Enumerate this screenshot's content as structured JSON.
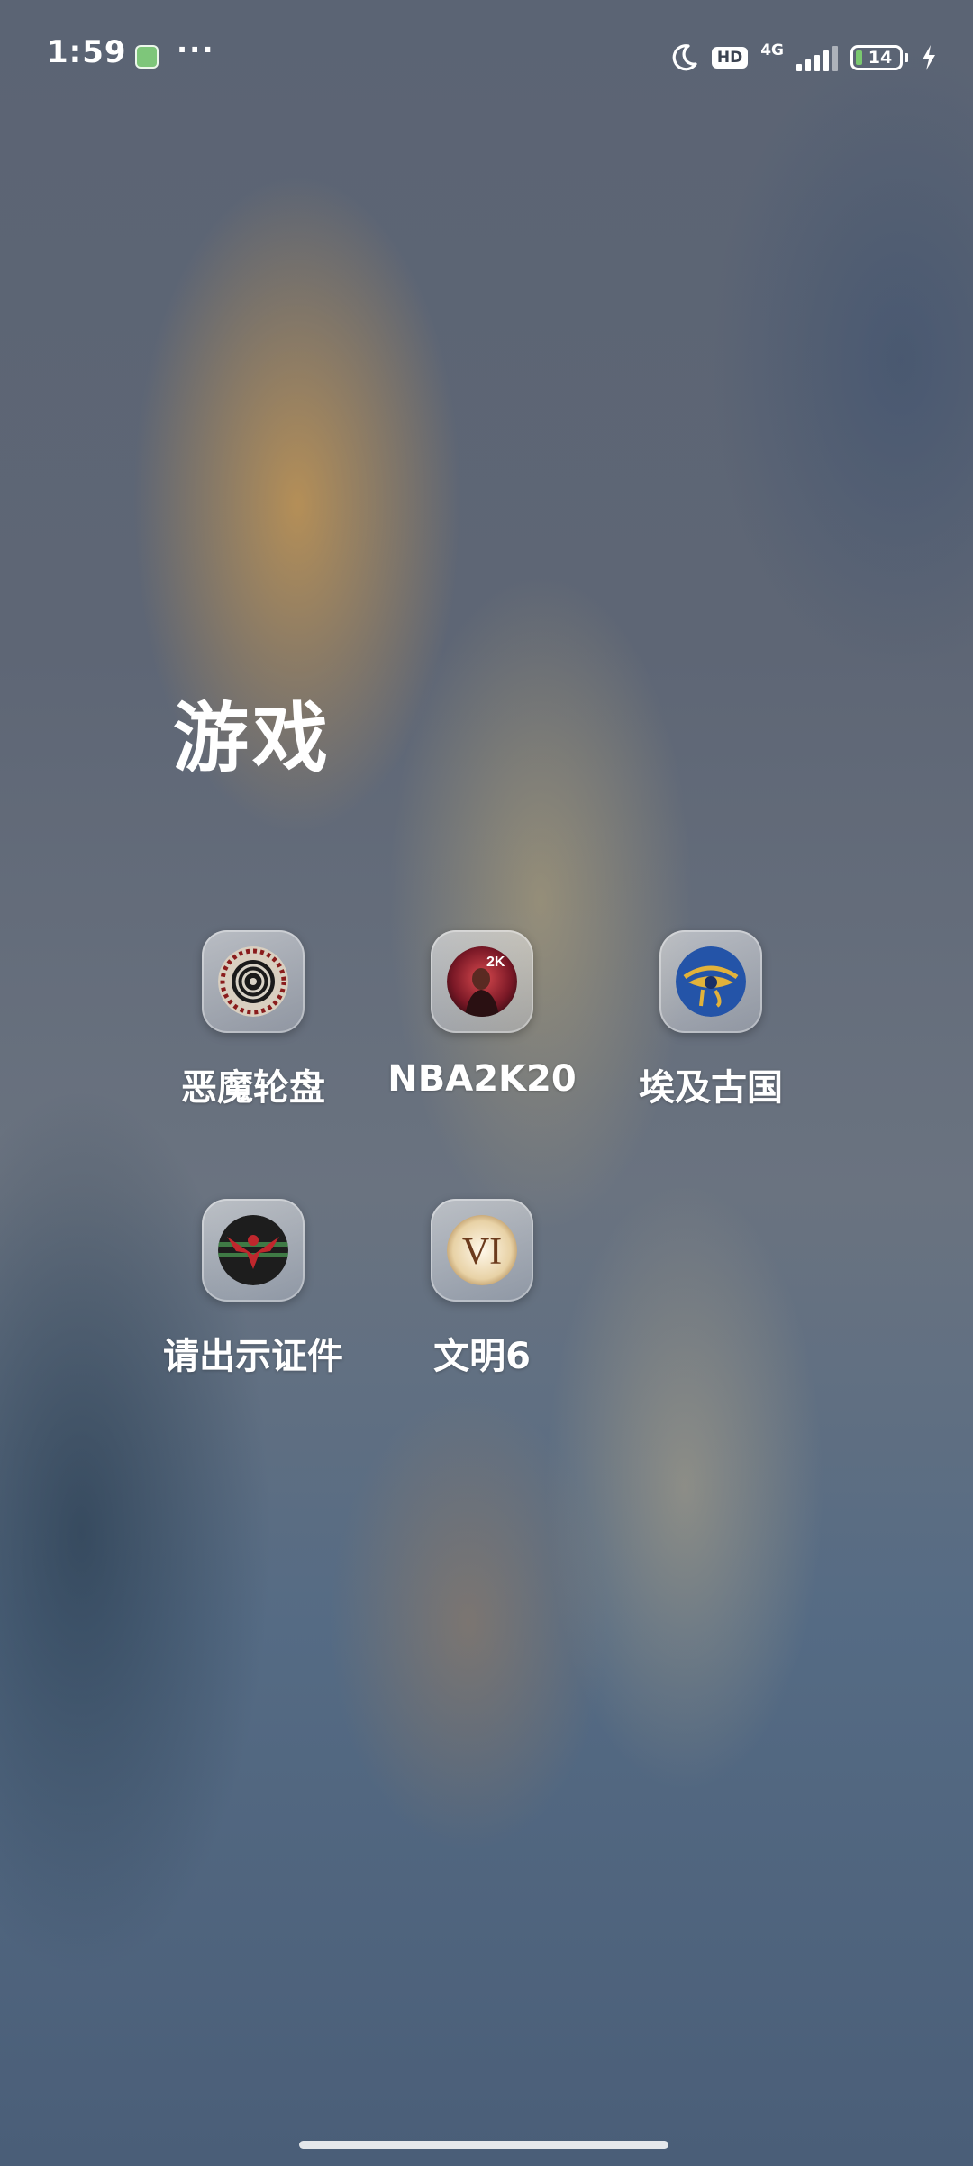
{
  "status_bar": {
    "time": "1:59",
    "more": "···",
    "hd": "HD",
    "network": "4G",
    "battery_level": "14",
    "icons": [
      "app-notification-icon",
      "moon-icon",
      "hd-icon",
      "signal-icon",
      "battery-icon",
      "charging-icon"
    ]
  },
  "folder": {
    "title": "游戏",
    "apps": [
      {
        "label": "恶魔轮盘",
        "icon": "buckshot-roulette-icon"
      },
      {
        "label": "NBA2K20",
        "icon": "nba2k20-icon"
      },
      {
        "label": "埃及古国",
        "icon": "eye-of-horus-icon"
      },
      {
        "label": "请出示证件",
        "icon": "papers-please-eagle-icon"
      },
      {
        "label": "文明6",
        "icon": "civilization-vi-icon"
      }
    ]
  },
  "colors": {
    "battery_fill": "#7ac86f",
    "notification_green": "#7ec67a"
  }
}
